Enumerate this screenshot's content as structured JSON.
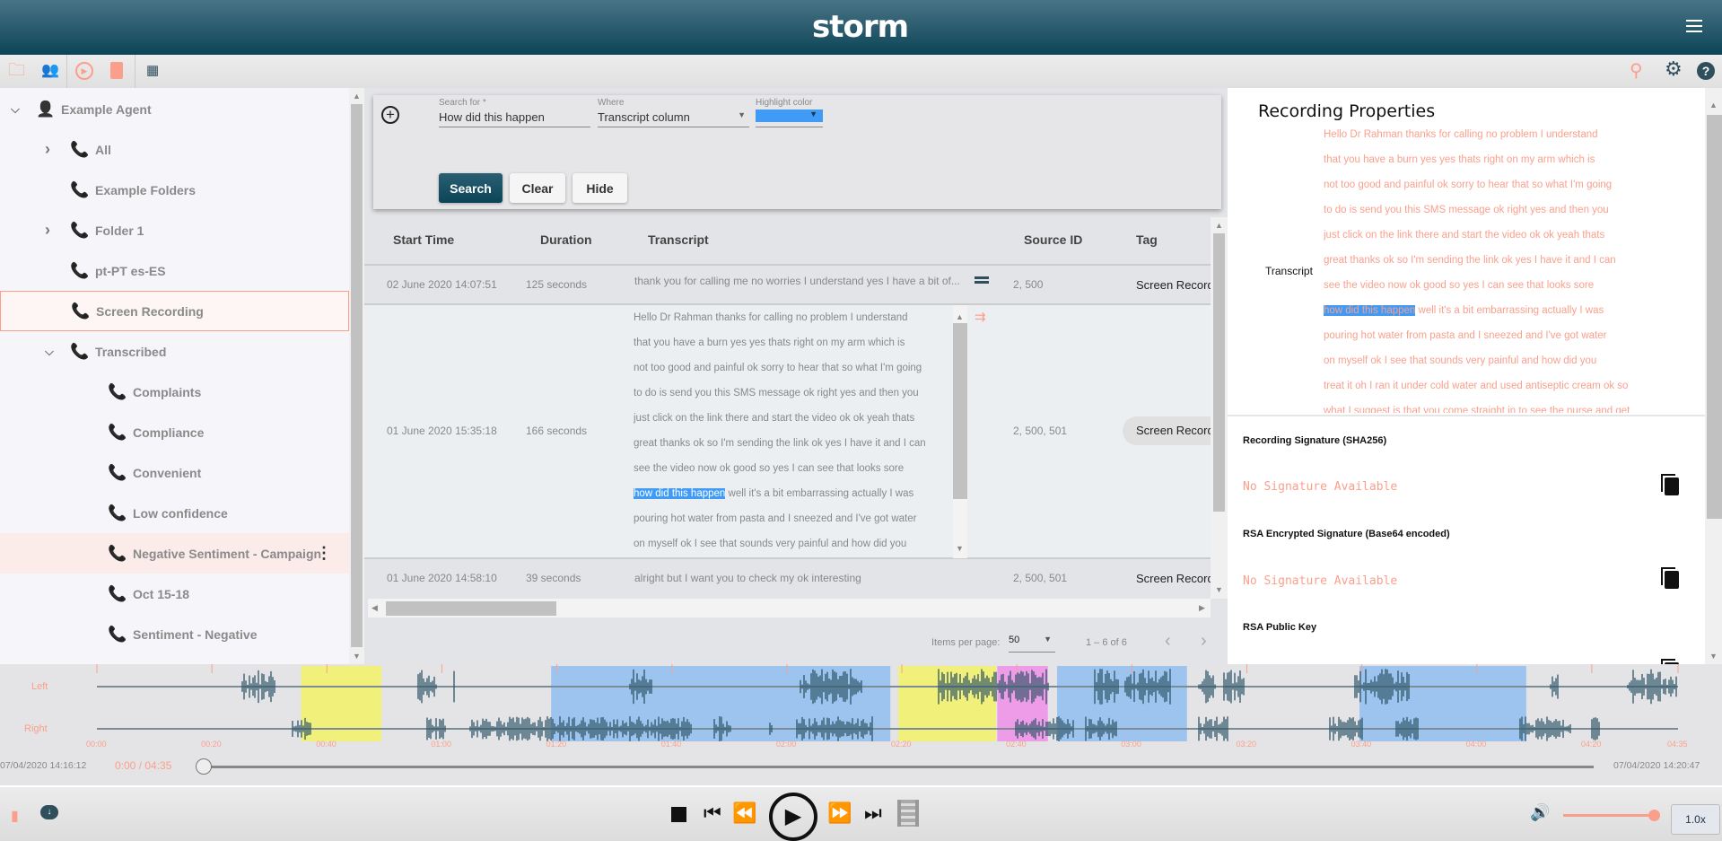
{
  "app": {
    "logo": "storm",
    "colors": {
      "header": "#0c4457",
      "accent": "#fb9f8c",
      "highlight": "#3f9bf5"
    }
  },
  "toolbar": {
    "left_icons": [
      "folder-icon",
      "users-icon",
      "play-circle-icon",
      "document-icon",
      "grid-icon"
    ],
    "right_icons": [
      "search-icon",
      "gear-icon",
      "help-icon"
    ]
  },
  "sidebar": {
    "items": [
      {
        "label": "Example Agent",
        "level": 0,
        "expand": "expanded",
        "icon": "person-icon"
      },
      {
        "label": "All",
        "level": 1,
        "expand": "collapsed"
      },
      {
        "label": "Example Folders",
        "level": 1,
        "expand": "none"
      },
      {
        "label": "Folder 1",
        "level": 1,
        "expand": "collapsed"
      },
      {
        "label": "pt-PT es-ES",
        "level": 1,
        "expand": "none"
      },
      {
        "label": "Screen Recording",
        "level": 1,
        "expand": "none",
        "selected": true
      },
      {
        "label": "Transcribed",
        "level": 1,
        "expand": "expanded"
      },
      {
        "label": "Complaints",
        "level": 2,
        "expand": "none"
      },
      {
        "label": "Compliance",
        "level": 2,
        "expand": "none"
      },
      {
        "label": "Convenient",
        "level": 2,
        "expand": "none"
      },
      {
        "label": "Low confidence",
        "level": 2,
        "expand": "none"
      },
      {
        "label": "Negative Sentiment - Campaign",
        "level": 2,
        "expand": "none",
        "hovered": true
      },
      {
        "label": "Oct 15-18",
        "level": 2,
        "expand": "none"
      },
      {
        "label": "Sentiment - Negative",
        "level": 2,
        "expand": "none"
      }
    ]
  },
  "search": {
    "search_for_label": "Search for *",
    "search_for_value": "How did this happen",
    "where_label": "Where",
    "where_value": "Transcript column",
    "highlight_label": "Highlight color",
    "highlight_value": "#3f9bf5",
    "search_btn": "Search",
    "clear_btn": "Clear",
    "hide_btn": "Hide"
  },
  "table": {
    "headers": [
      "Start Time",
      "Duration",
      "Transcript",
      "Source ID",
      "Tag"
    ],
    "rows": [
      {
        "start": "02 June 2020 14:07:51",
        "duration": "125 seconds",
        "transcript": "thank you for calling me no worries I understand yes I have a bit of...",
        "source": "2, 500",
        "tag": "Screen Record"
      },
      {
        "start": "01 June 2020 15:35:18",
        "duration": "166 seconds",
        "source": "2, 500, 501",
        "tag": "Screen Record"
      },
      {
        "start": "01 June 2020 14:58:10",
        "duration": "39 seconds",
        "transcript": "alright but I want you to check my ok interesting",
        "source": "2, 500, 501",
        "tag": "Screen Record"
      }
    ],
    "expanded_lines": [
      "Hello Dr Rahman thanks for calling no problem I understand",
      "that you have a burn yes yes thats right on my arm which is",
      "not too good and painful ok sorry to hear that so what I'm going",
      "to do is send you this SMS message ok right yes and then you",
      "just click on the link there and start the video ok ok yeah thats",
      "great thanks ok so I'm sending the link ok yes I have it and I can",
      "see the video now ok good so yes I can see that looks sore"
    ],
    "highlight_match": "how did this happen",
    "highlight_rest": " well it's a bit embarrassing actually I was",
    "expanded_lines_after": [
      "pouring hot water from pasta and I sneezed and I've got water",
      "on myself ok I see that sounds very painful and how did you"
    ],
    "pagination": {
      "items_per_page_label": "Items per page:",
      "items_per_page": "50",
      "range": "1 – 6 of 6"
    }
  },
  "properties": {
    "title": "Recording Properties",
    "transcript_label": "Transcript",
    "lines_before": [
      "Hello Dr Rahman thanks for calling no problem I understand",
      "that you have a burn yes yes thats right on my arm which is",
      "not too good and painful ok sorry to hear that so what I'm going",
      "to do is send you this SMS message ok right yes and then you",
      "just click on the link there and start the video ok ok yeah thats",
      "great thanks ok so I'm sending the link ok yes I have it and I can",
      "see the video now ok good so yes I can see that looks sore"
    ],
    "highlight_match": "how did this happen",
    "highlight_rest": " well it's a bit embarrassing actually I was",
    "lines_after": [
      "pouring hot water from pasta and I sneezed and I've got water",
      "on myself ok I see that sounds very painful and how did you",
      "treat it oh I ran it under cold water and used antiseptic cream ok so",
      "what I suggest is that you come straight in to see the nurse and get"
    ],
    "sig_sha_label": "Recording Signature (SHA256)",
    "sig_sha_value": "No Signature Available",
    "sig_rsa_label": "RSA Encrypted Signature (Base64 encoded)",
    "sig_rsa_value": "No Signature Available",
    "pubkey_label": "RSA Public Key"
  },
  "waveform": {
    "left_label": "Left",
    "right_label": "Right",
    "ticks": [
      "00:00",
      "00:20",
      "00:40",
      "01:00",
      "01:20",
      "01:40",
      "02:00",
      "02:20",
      "02:40",
      "03:00",
      "03:20",
      "03:40",
      "04:00",
      "04:20",
      "04:35"
    ],
    "duration_seconds": 275,
    "highlights": [
      {
        "start": 35.5,
        "end": 49.5,
        "color": "#f0f07a"
      },
      {
        "start": 79,
        "end": 138,
        "color": "#9cc4ee"
      },
      {
        "start": 139.4,
        "end": 156.4,
        "color": "#f0f07a"
      },
      {
        "start": 156.6,
        "end": 165.4,
        "color": "#ee9be8"
      },
      {
        "start": 167,
        "end": 189.6,
        "color": "#9cc4ee"
      },
      {
        "start": 219.6,
        "end": 248.6,
        "color": "#9cc4ee"
      }
    ],
    "start_datetime": "07/04/2020 14:16:12",
    "end_datetime": "07/04/2020 14:20:47",
    "position": "0:00 / 04:35",
    "progress": 0
  },
  "player": {
    "speed": "1.0x",
    "volume": 1.0
  }
}
